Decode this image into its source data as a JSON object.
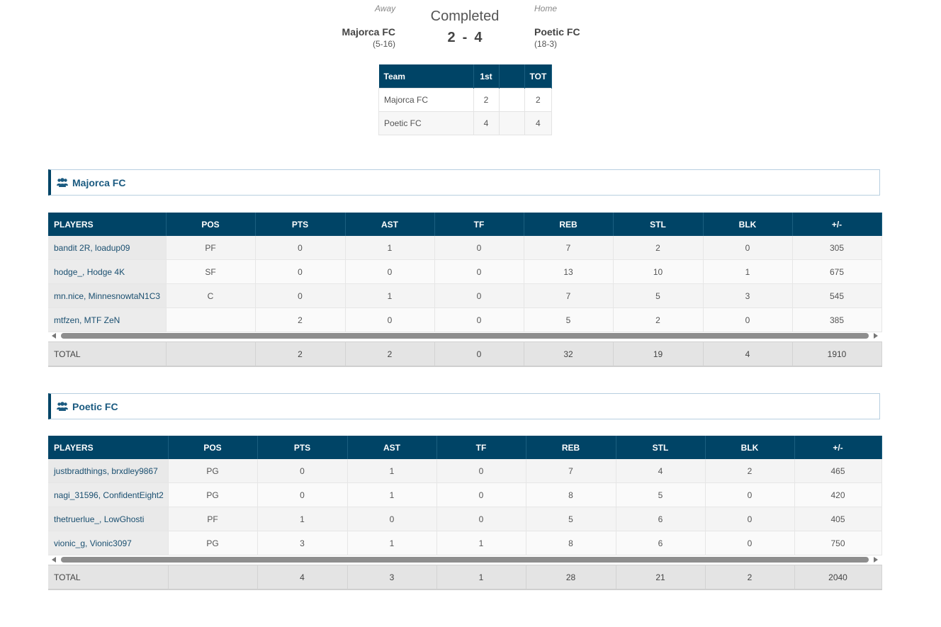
{
  "game": {
    "away_label": "Away",
    "home_label": "Home",
    "status": "Completed",
    "away_team": "Majorca FC",
    "away_record": "(5-16)",
    "home_team": "Poetic FC",
    "home_record": "(18-3)",
    "away_score": "2",
    "home_score": "4",
    "score_sep": "-"
  },
  "linescore": {
    "headers": [
      "Team",
      "1st",
      "",
      "TOT"
    ],
    "rows": [
      {
        "team": "Majorca FC",
        "p1": "2",
        "p2": "",
        "tot": "2"
      },
      {
        "team": "Poetic FC",
        "p1": "4",
        "p2": "",
        "tot": "4"
      }
    ]
  },
  "columns": [
    "PLAYERS",
    "POS",
    "PTS",
    "AST",
    "TF",
    "REB",
    "STL",
    "BLK",
    "+/-"
  ],
  "teams": [
    {
      "name": "Majorca FC",
      "players": [
        {
          "name": "bandit 2R, loadup09",
          "pos": "PF",
          "pts": "0",
          "ast": "1",
          "tf": "0",
          "reb": "7",
          "stl": "2",
          "blk": "0",
          "pm": "305"
        },
        {
          "name": "hodge_, Hodge 4K",
          "pos": "SF",
          "pts": "0",
          "ast": "0",
          "tf": "0",
          "reb": "13",
          "stl": "10",
          "blk": "1",
          "pm": "675"
        },
        {
          "name": "mn.nice, MinnesnowtaN1C3",
          "pos": "C",
          "pts": "0",
          "ast": "1",
          "tf": "0",
          "reb": "7",
          "stl": "5",
          "blk": "3",
          "pm": "545"
        },
        {
          "name": "mtfzen, MTF ZeN",
          "pos": "",
          "pts": "2",
          "ast": "0",
          "tf": "0",
          "reb": "5",
          "stl": "2",
          "blk": "0",
          "pm": "385"
        }
      ],
      "total": {
        "label": "TOTAL",
        "pos": "",
        "pts": "2",
        "ast": "2",
        "tf": "0",
        "reb": "32",
        "stl": "19",
        "blk": "4",
        "pm": "1910"
      }
    },
    {
      "name": "Poetic FC",
      "players": [
        {
          "name": "justbradthings, brxdley9867",
          "pos": "PG",
          "pts": "0",
          "ast": "1",
          "tf": "0",
          "reb": "7",
          "stl": "4",
          "blk": "2",
          "pm": "465"
        },
        {
          "name": "nagi_31596, ConfidentEight2",
          "pos": "PG",
          "pts": "0",
          "ast": "1",
          "tf": "0",
          "reb": "8",
          "stl": "5",
          "blk": "0",
          "pm": "420"
        },
        {
          "name": "thetruerlue_, LowGhosti",
          "pos": "PF",
          "pts": "1",
          "ast": "0",
          "tf": "0",
          "reb": "5",
          "stl": "6",
          "blk": "0",
          "pm": "405"
        },
        {
          "name": "vionic_g, Vionic3097",
          "pos": "PG",
          "pts": "3",
          "ast": "1",
          "tf": "1",
          "reb": "8",
          "stl": "6",
          "blk": "0",
          "pm": "750"
        }
      ],
      "total": {
        "label": "TOTAL",
        "pos": "",
        "pts": "4",
        "ast": "3",
        "tf": "1",
        "reb": "28",
        "stl": "21",
        "blk": "2",
        "pm": "2040"
      }
    }
  ],
  "icons": {
    "team_icon": "users-icon"
  },
  "colors": {
    "header_bg": "#004466",
    "link": "#1a4f70",
    "banner_text": "#1a5a80"
  }
}
